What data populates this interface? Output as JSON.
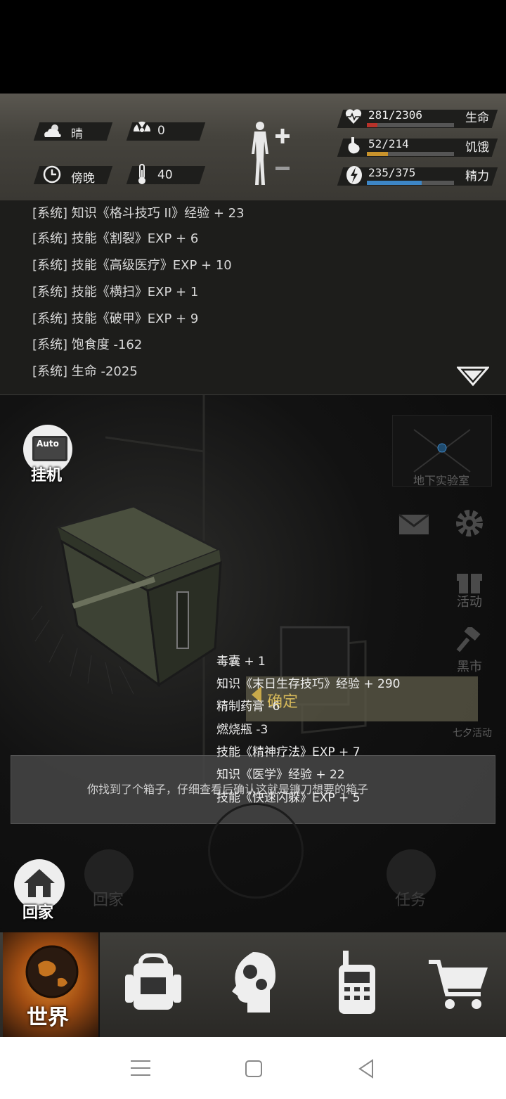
{
  "status": {
    "weather": {
      "icon": "cloud-sun-icon",
      "label": "晴"
    },
    "radiation": {
      "icon": "radiation-icon",
      "value": "0"
    },
    "time": {
      "icon": "clock-icon",
      "label": "傍晚"
    },
    "temperature": {
      "icon": "thermometer-icon",
      "value": "40"
    },
    "stats": [
      {
        "name": "生命",
        "value": "281/2306",
        "fraction": 0.122,
        "color": "#b8322a",
        "icon": "heart-icon"
      },
      {
        "name": "饥饿",
        "value": "52/214",
        "fraction": 0.243,
        "color": "#c9932c",
        "icon": "stomach-icon"
      },
      {
        "name": "精力",
        "value": "235/375",
        "fraction": 0.627,
        "color": "#3d86c6",
        "icon": "energy-icon"
      }
    ]
  },
  "log": {
    "lines": [
      "[系统] 知识《格斗技巧 II》经验 + 23",
      "[系统] 技能《割裂》EXP + 6",
      "[系统] 技能《高级医疗》EXP + 10",
      "[系统] 技能《横扫》EXP + 1",
      "[系统] 技能《破甲》EXP + 9",
      "[系统] 饱食度 -162",
      "[系统] 生命 -2025"
    ]
  },
  "scene": {
    "auto_label": "挂机",
    "auto_badge": "Auto",
    "map_label": "地下实验室",
    "side": {
      "event": "活动",
      "market": "黑市",
      "qixi": "七夕活动"
    },
    "faded_home": "回家",
    "faded_task": "任务",
    "confirm_label": "确定",
    "rewards": [
      "毒囊 + 1",
      "知识《末日生存技巧》经验 + 290",
      "精制药膏 -6",
      "燃烧瓶 -3",
      "技能《精神疗法》EXP + 7",
      "知识《医学》经验 + 22",
      "技能《快速闪躲》EXP + 5"
    ],
    "message": "你找到了个箱子，仔细查看后确认这就是镰刀想要的箱子",
    "home_label": "回家"
  },
  "bottom_tabs": [
    {
      "label": "世界",
      "icon": "globe-icon",
      "active": true
    },
    {
      "label": "",
      "icon": "backpack-icon"
    },
    {
      "label": "",
      "icon": "brain-gear-icon"
    },
    {
      "label": "",
      "icon": "walkie-talkie-icon"
    },
    {
      "label": "",
      "icon": "cart-icon"
    }
  ]
}
